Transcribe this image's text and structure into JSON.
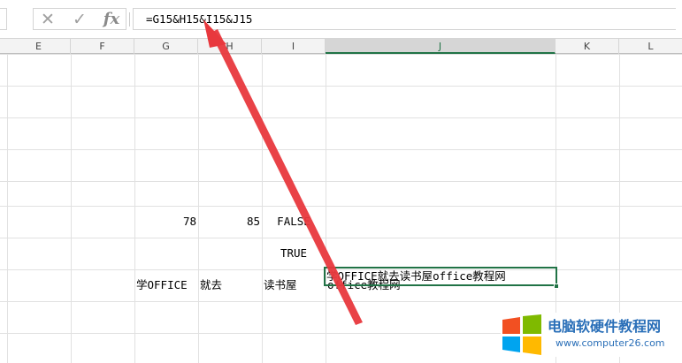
{
  "formula_bar": {
    "cancel_icon": "✕",
    "enter_icon": "✓",
    "fx_label": "fx",
    "formula": "=G15&H15&I15&J15"
  },
  "columns": [
    {
      "name": "E"
    },
    {
      "name": "F"
    },
    {
      "name": "G"
    },
    {
      "name": "H"
    },
    {
      "name": "I"
    },
    {
      "name": "J",
      "active": true
    },
    {
      "name": "K"
    },
    {
      "name": "L"
    }
  ],
  "cells": {
    "g_num": "78",
    "h_num": "85",
    "i_false": "FALSE",
    "i_true": "TRUE",
    "g_text": "学OFFICE",
    "h_text": "就去",
    "i_text": "读书屋",
    "j_text": "office教程网",
    "j_active": "学OFFICE就去读书屋office教程网"
  },
  "watermark": {
    "title": "电脑软硬件教程网",
    "url": "www.computer26.com",
    "logo_colors": [
      "#f25022",
      "#7fba00",
      "#00a4ef",
      "#ffb900"
    ]
  },
  "colors": {
    "accent": "#217346",
    "arrow": "#e8383d"
  }
}
